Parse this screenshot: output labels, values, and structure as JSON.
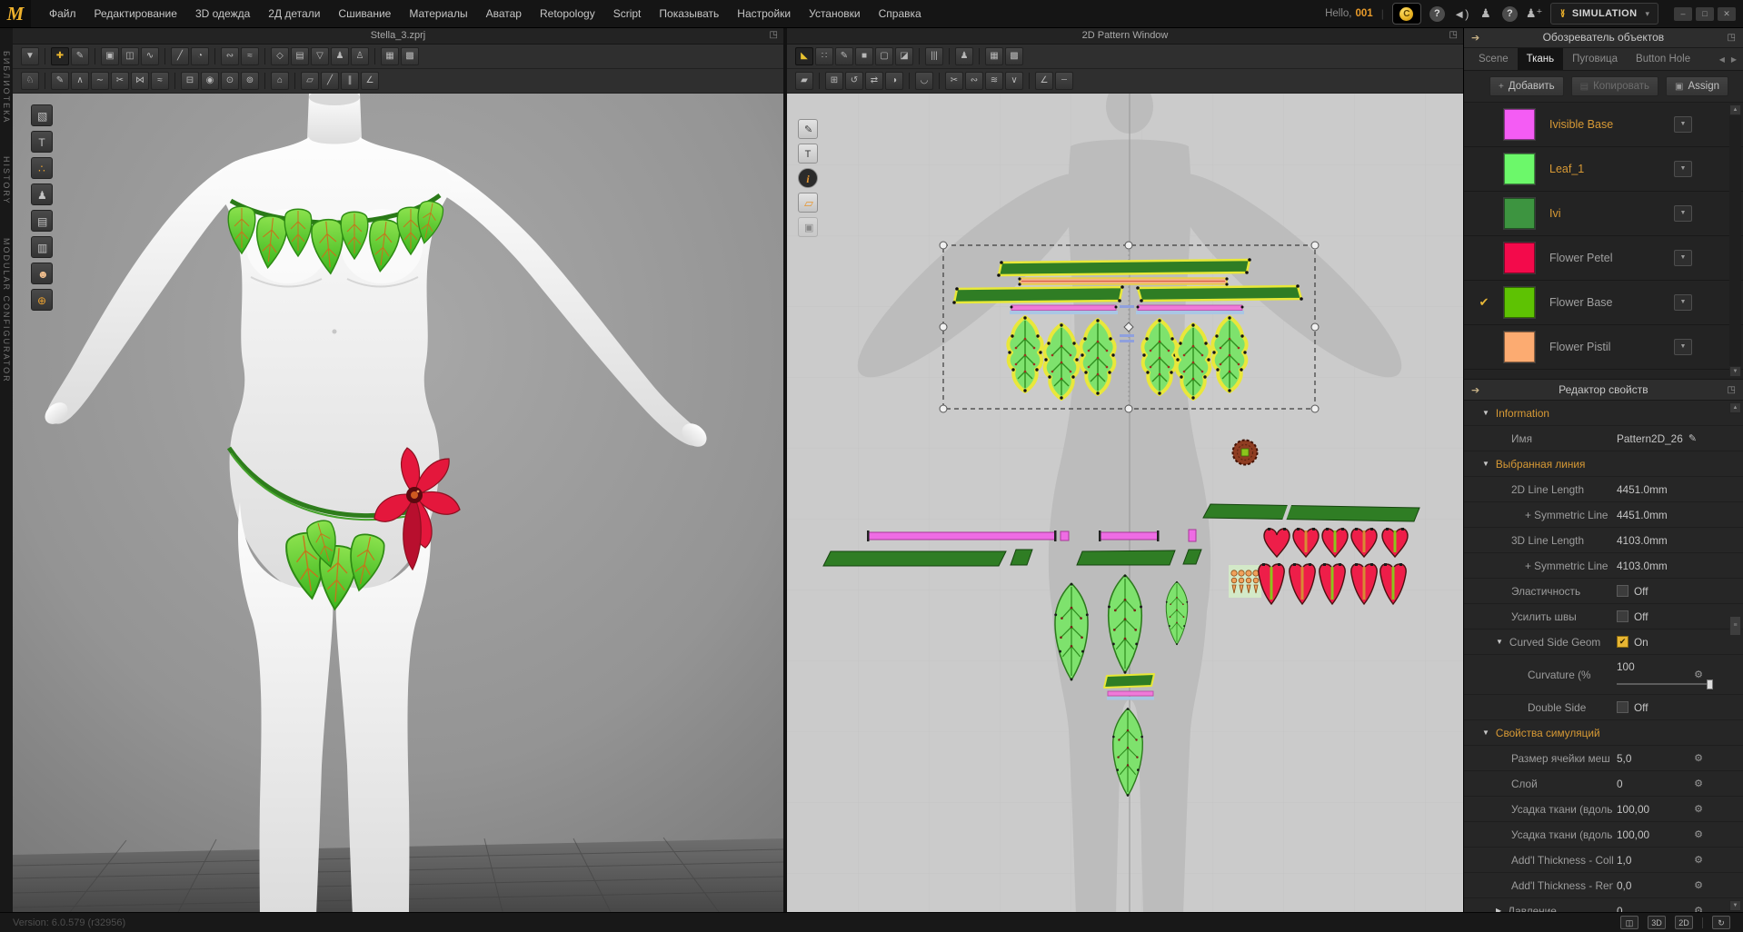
{
  "topbar": {
    "logo": "M",
    "menus": [
      "Файл",
      "Редактирование",
      "3D одежда",
      "2Д детали",
      "Сшивание",
      "Материалы",
      "Аватар",
      "Retopology",
      "Script",
      "Показывать",
      "Настройки",
      "Установки",
      "Справка"
    ],
    "hello": "Hello,",
    "user": "001",
    "icons": [
      {
        "name": "coin-icon",
        "glyph": "C",
        "coin": true
      },
      {
        "name": "sound-icon",
        "glyph": "◄)"
      },
      {
        "name": "account-icon",
        "glyph": "♟"
      },
      {
        "name": "help-icon",
        "glyph": "?",
        "circle": true
      },
      {
        "name": "invite-friend-icon",
        "glyph": "♟⁺"
      }
    ],
    "simulation_label": "SIMULATION",
    "simulation_caret": "▾",
    "window_controls": [
      {
        "name": "minimize-button",
        "glyph": "–"
      },
      {
        "name": "restore-button",
        "glyph": "□"
      },
      {
        "name": "close-button",
        "glyph": "✕"
      }
    ]
  },
  "left_rail": {
    "items": [
      "БИБЛИОТЕКА",
      "HISTORY",
      "MODULAR CONFIGURATOR"
    ]
  },
  "window3d": {
    "title": "Stella_3.zprj",
    "toolbar_row1": [
      {
        "name": "tool-simulate",
        "glyph": "▼"
      },
      {
        "sep": true
      },
      {
        "name": "tool-select-move",
        "glyph": "✚",
        "active": true
      },
      {
        "name": "tool-select-mesh",
        "glyph": "✎"
      },
      {
        "sep": true
      },
      {
        "name": "tool-pin-box",
        "glyph": "▣"
      },
      {
        "name": "tool-pin-segment",
        "glyph": "◫"
      },
      {
        "name": "tool-pin-curve",
        "glyph": "∿"
      },
      {
        "sep": true
      },
      {
        "name": "tool-needle",
        "glyph": "╱"
      },
      {
        "name": "tool-point-on-sphere",
        "glyph": "◔"
      },
      {
        "sep": true
      },
      {
        "name": "tool-tack-free",
        "glyph": "∾"
      },
      {
        "name": "tool-tack-on-avatar",
        "glyph": "≈"
      },
      {
        "sep": true
      },
      {
        "name": "tool-fold-arrangement",
        "glyph": "◇"
      },
      {
        "name": "tool-clone-layer",
        "glyph": "▤"
      },
      {
        "name": "tool-garment-fit",
        "glyph": "▽"
      },
      {
        "name": "tool-show-avatar",
        "glyph": "♟"
      },
      {
        "name": "tool-show-mannequin",
        "glyph": "♙"
      },
      {
        "sep": true
      },
      {
        "name": "tool-grid-snap",
        "glyph": "▦"
      },
      {
        "name": "tool-grid-transform",
        "glyph": "▩"
      }
    ],
    "toolbar_row2": [
      {
        "name": "tool-walk-avatar",
        "glyph": "♘"
      },
      {
        "sep": true
      },
      {
        "name": "tool-sculpt",
        "glyph": "✎"
      },
      {
        "name": "tool-pinch",
        "glyph": "∧"
      },
      {
        "name": "tool-smooth",
        "glyph": "∼"
      },
      {
        "name": "tool-edit-sewing-3d",
        "glyph": "✂"
      },
      {
        "name": "tool-sew-free-3d",
        "glyph": "⋈"
      },
      {
        "name": "tool-sew-multi-3d",
        "glyph": "≈"
      },
      {
        "sep": true
      },
      {
        "name": "tool-zipper",
        "glyph": "⊟"
      },
      {
        "name": "tool-button",
        "glyph": "◉"
      },
      {
        "name": "tool-buttonhole",
        "glyph": "⊙"
      },
      {
        "name": "tool-fasten",
        "glyph": "⊚"
      },
      {
        "sep": true
      },
      {
        "name": "tool-stage",
        "glyph": "⌂"
      },
      {
        "sep": true
      },
      {
        "name": "tool-flatten",
        "glyph": "▱"
      },
      {
        "name": "tool-slash",
        "glyph": "╱"
      },
      {
        "name": "tool-measure-3d",
        "glyph": "∥"
      },
      {
        "name": "tool-angle-3d",
        "glyph": "∠"
      }
    ],
    "side_icons": [
      {
        "name": "library-box-icon",
        "glyph": "▧"
      },
      {
        "name": "library-garment-icon",
        "glyph": "T"
      },
      {
        "name": "library-trims-icon",
        "glyph": "∴",
        "tint": "#e8a030"
      },
      {
        "name": "library-avatar-icon",
        "glyph": "♟"
      },
      {
        "name": "library-fabric-icon",
        "glyph": "▤"
      },
      {
        "name": "library-hardware-icon",
        "glyph": "▥"
      },
      {
        "name": "library-stage-icon",
        "glyph": "☻",
        "tint": "#f3c08e"
      },
      {
        "name": "library-online-icon",
        "glyph": "⊕",
        "tint": "#e8a030"
      }
    ]
  },
  "window2d": {
    "title": "2D Pattern Window",
    "toolbar_row1": [
      {
        "name": "tool-transform-pattern",
        "glyph": "◣",
        "active": true,
        "yellow": true
      },
      {
        "name": "tool-edit-pattern",
        "glyph": "∷"
      },
      {
        "name": "tool-edit-curve",
        "glyph": "✎"
      },
      {
        "name": "tool-make-rectangle",
        "glyph": "■"
      },
      {
        "name": "tool-make-polygon",
        "glyph": "▢"
      },
      {
        "name": "tool-dart",
        "glyph": "◪"
      },
      {
        "sep": true
      },
      {
        "name": "tool-pleats",
        "glyph": "|||"
      },
      {
        "sep": true
      },
      {
        "name": "tool-show-avatar-2d",
        "glyph": "♟"
      },
      {
        "sep": true
      },
      {
        "name": "tool-grid-2d",
        "glyph": "▦"
      },
      {
        "name": "tool-grid-pattern-2d",
        "glyph": "▩"
      }
    ],
    "toolbar_row2": [
      {
        "name": "tool-edit-texture",
        "glyph": "▰"
      },
      {
        "sep": true
      },
      {
        "name": "tool-move-pattern",
        "glyph": "⊞"
      },
      {
        "name": "tool-rotate-pattern",
        "glyph": "↺"
      },
      {
        "name": "tool-flip-pattern",
        "glyph": "⇄"
      },
      {
        "name": "tool-assign-fabric",
        "glyph": "◑"
      },
      {
        "sep": true
      },
      {
        "name": "tool-iron",
        "glyph": "◡"
      },
      {
        "sep": true
      },
      {
        "name": "tool-edit-sewing-2d",
        "glyph": "✂"
      },
      {
        "name": "tool-sew-free-2d",
        "glyph": "∾"
      },
      {
        "name": "tool-sew-multi-2d",
        "glyph": "≋"
      },
      {
        "name": "tool-notch",
        "glyph": "∨"
      },
      {
        "sep": true
      },
      {
        "name": "tool-seam-allowance",
        "glyph": "∠"
      },
      {
        "name": "tool-guideline",
        "glyph": "┄"
      }
    ],
    "side_icons": [
      {
        "name": "show-sewing-icon",
        "glyph": "✎"
      },
      {
        "name": "show-garment-icon",
        "glyph": "T"
      },
      {
        "name": "show-info-icon",
        "glyph": "i",
        "dark": true
      },
      {
        "name": "active-pattern-icon",
        "glyph": "▱",
        "orange": true
      },
      {
        "name": "lock-pattern-icon",
        "glyph": "▣",
        "dim": true
      }
    ]
  },
  "object_browser": {
    "title": "Обозреватель объектов",
    "tabs": [
      {
        "label": "Scene",
        "name": "tab-scene"
      },
      {
        "label": "Ткань",
        "name": "tab-fabric",
        "active": true
      },
      {
        "label": "Пуговица",
        "name": "tab-button",
        "active": false
      },
      {
        "label": "Button Hole",
        "name": "tab-buttonhole",
        "active": false
      }
    ],
    "tab_nav": [
      {
        "name": "tabs-scroll-left-icon",
        "glyph": "◀"
      },
      {
        "name": "tabs-scroll-right-icon",
        "glyph": "▶"
      }
    ],
    "buttons": [
      {
        "name": "add-fabric-button",
        "glyph": "+",
        "label": "Добавить"
      },
      {
        "name": "copy-fabric-button",
        "glyph": "▤",
        "label": "Копировать",
        "disabled": true
      },
      {
        "name": "assign-fabric-button",
        "glyph": "▣",
        "label": "Assign"
      }
    ],
    "fabrics": [
      {
        "name": "Ivisible Base",
        "color": "#f45cf4",
        "highlight": true
      },
      {
        "name": "Leaf_1",
        "color": "#6cf86a",
        "highlight": true
      },
      {
        "name": "Ivi",
        "color": "#3d9440",
        "highlight": true
      },
      {
        "name": "Flower Petel",
        "color": "#f30a4b"
      },
      {
        "name": "Flower Base",
        "color": "#5ec203",
        "selected": true
      },
      {
        "name": "Flower Pistil",
        "color": "#fcab71"
      }
    ]
  },
  "property_editor": {
    "title": "Редактор свойств",
    "rows": [
      {
        "section": true,
        "arrow_down": true,
        "label": "Information"
      },
      {
        "label": "Имя",
        "value": "Pattern2D_26",
        "pencil": true
      },
      {
        "section": true,
        "arrow_down": true,
        "label": "Выбранная линия"
      },
      {
        "label": "2D Line Length",
        "value": "4451.0mm"
      },
      {
        "label": "+ Symmetric Line",
        "value": "4451.0mm",
        "ind": true
      },
      {
        "label": "3D Line Length",
        "value": "4103.0mm"
      },
      {
        "label": "+ Symmetric Line",
        "value": "4103.0mm",
        "ind": true
      },
      {
        "label": "Эластичность",
        "value": "Off",
        "check_off": true
      },
      {
        "label": "Усилить швы",
        "value": "Off",
        "check_off": true
      },
      {
        "label": "Curved Side Geom",
        "value": "On",
        "check_on": true,
        "arrow_down": true,
        "grp": true
      },
      {
        "label": "Curvature (%",
        "value": "100",
        "wrench": true,
        "slider": true,
        "tall": true,
        "ind2": true
      },
      {
        "label": "Double Side",
        "value": "Off",
        "check_off": true,
        "ind2": true
      },
      {
        "section": true,
        "arrow_down": true,
        "label": "Свойства симуляций"
      },
      {
        "label": "Размер ячейки меш",
        "value": "5,0",
        "wrench": true
      },
      {
        "label": "Слой",
        "value": "0",
        "wrench": true
      },
      {
        "label": "Усадка ткани (вдоль",
        "value": "100,00",
        "wrench": true
      },
      {
        "label": "Усадка ткани (вдоль",
        "value": "100,00",
        "wrench": true
      },
      {
        "label": "Add'l Thickness - Colli",
        "value": "1,0",
        "wrench": true
      },
      {
        "label": "Add'l Thickness - Ren",
        "value": "0,0",
        "wrench": true
      },
      {
        "label": "Давление",
        "value": "0",
        "wrench": true,
        "arrow_right": true,
        "grp": true
      }
    ]
  },
  "statusbar": {
    "version": "Version: 6.0.579 (r32956)",
    "icons": [
      {
        "name": "split-view-button",
        "glyph": "◫"
      },
      {
        "name": "view-3d-button",
        "glyph": "3D"
      },
      {
        "name": "view-2d-button",
        "glyph": "2D"
      },
      {
        "sep": true
      },
      {
        "name": "sync-button",
        "glyph": "↻"
      }
    ]
  }
}
